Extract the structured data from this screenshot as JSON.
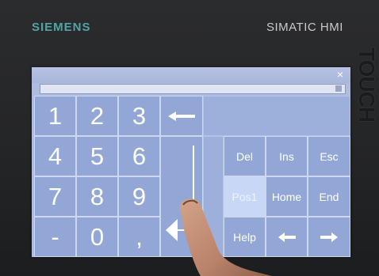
{
  "device": {
    "brand": "SIEMENS",
    "model": "SIMATIC HMI",
    "side_label": "TOUCH"
  },
  "dialog": {
    "close_glyph": "×",
    "entry_value": ""
  },
  "keypad": {
    "digits": [
      "1",
      "2",
      "3",
      "4",
      "5",
      "6",
      "7",
      "8",
      "9",
      "0"
    ],
    "minus": "-",
    "comma": ","
  },
  "edit_keys": {
    "del": "Del",
    "ins": "Ins",
    "esc": "Esc",
    "pos1": "Pos1",
    "home": "Home",
    "end": "End",
    "help": "Help"
  },
  "icons": {
    "backspace": "arrow-left-icon",
    "enter": "enter-arrow-icon",
    "cursor_left": "arrow-left-icon",
    "cursor_right": "arrow-right-icon"
  },
  "colors": {
    "brand_teal": "#4fa5a7",
    "screen_bg": "#aebddf",
    "key_bg": "#92a7d6",
    "key_border": "#cdd7ef",
    "key_active": "#c8d7f6"
  }
}
